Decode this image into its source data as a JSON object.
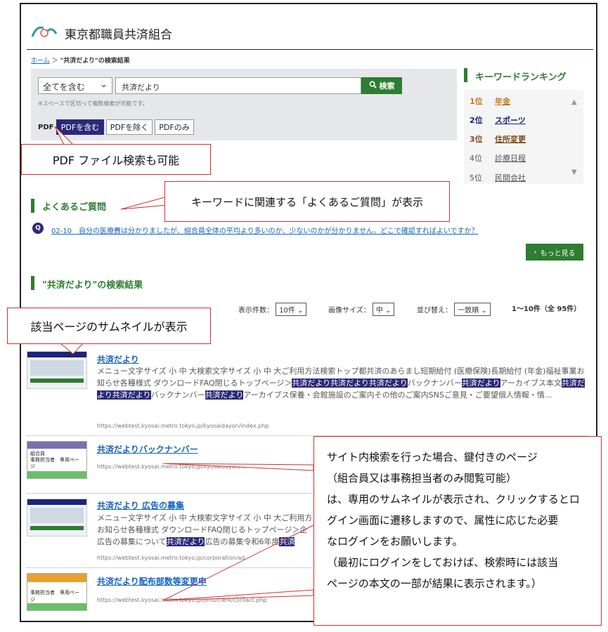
{
  "header": {
    "site_title": "東京都職員共済組合"
  },
  "breadcrumb": {
    "home": "ホーム",
    "separator": "＞",
    "current": "\"共済だより\"の検索結果"
  },
  "search": {
    "scope_value": "全てを含む",
    "keyword_value": "共済だより",
    "button_label": "検索",
    "hint": "※スペースで区切って複数検索が可能です。",
    "pdf_label": "PDF",
    "pdf_options": [
      "PDFを含む",
      "PDFを除く",
      "PDFのみ"
    ],
    "pdf_selected": "PDFを含む"
  },
  "ranking": {
    "title": "キーワードランキング",
    "items": [
      {
        "rank": "1位",
        "word": "年金",
        "color": "#c07a1a"
      },
      {
        "rank": "2位",
        "word": "スポーツ",
        "color": "#1a237e"
      },
      {
        "rank": "3位",
        "word": "住所変更",
        "color": "#7a4a1a"
      },
      {
        "rank": "4位",
        "word": "診療日程",
        "color": "#555555"
      },
      {
        "rank": "5位",
        "word": "民間会社",
        "color": "#555555"
      }
    ]
  },
  "faq": {
    "title": "よくあるご質問",
    "icon_label": "Q",
    "items": [
      "02-10　自分の医療費は分かりましたが、組合員全体の平均より多いのか、少ないのかが分かりません。どこで確認すればよいですか？"
    ],
    "more_button": "もっと見る"
  },
  "results": {
    "title": "\"共済だより\"の検索結果",
    "count_label": "表示件数：",
    "count_value": "10件",
    "image_size_label": "画像サイズ：",
    "image_size_value": "中",
    "sort_label": "並び替え：",
    "sort_value": "一致順",
    "range": "1〜10件（全 95件）",
    "items": [
      {
        "title": "共済だより",
        "snippet_parts": [
          {
            "t": "メニュー文字サイズ 小 中 大検索文字サイズ 小 中 大ご利用方法検索トップ都共済のあらまし短期給付 (医療保険)長期給付 (年金)福祉事業お知らせ各種様式 ダウンロードFAQ閉じるトップページ＞",
            "h": false
          },
          {
            "t": "共済だより共済だより共済だより",
            "h": true
          },
          {
            "t": "バックナンバー",
            "h": false
          },
          {
            "t": "共済だより",
            "h": true
          },
          {
            "t": "アーカイブス本文",
            "h": false
          },
          {
            "t": "共済だより共済だより",
            "h": true
          },
          {
            "t": "バックナンバー",
            "h": false
          },
          {
            "t": "共済だより",
            "h": true
          },
          {
            "t": "アーカイブス保養・会館施設のご案内その他のご案内SNSご意見・ご要望個人情報・情...",
            "h": false
          }
        ],
        "url": "https://webtest.kyosai.metro.tokyo.jp/kyosaidayori/index.php"
      },
      {
        "title": "共済だよりバックナンバー",
        "thumb_text": [
          "組合員",
          "事務担当者　専用ページ"
        ],
        "url": "https://webtest.kyosai.metro.tokyo.jp/kyosaidayori/..."
      },
      {
        "title": "共済だより 広告の募集",
        "snippet_parts": [
          {
            "t": "メニュー文字サイズ 小 中 大検索文字サイズ 小 中 大ご利用方",
            "h": false
          },
          {
            "t": "お知らせ各種様式 ダウンロードFAQ閉じるトップページ＞企",
            "h": false
          },
          {
            "t": "広告の募集について",
            "h": false
          },
          {
            "t": "共済だより",
            "h": true
          },
          {
            "t": "広告の募集令和6年度",
            "h": false
          },
          {
            "t": "共済",
            "h": true
          }
        ],
        "url": "https://webtest.kyosai.metro.tokyo.jp/corporation/ad"
      },
      {
        "title": "共済だより配布部数等変更申",
        "thumb_text": [
          "事務担当者　専用ページ"
        ],
        "url": "https://webtest.kyosai.metro.tokyo.jp/jimu/clerk/contact.php"
      }
    ]
  },
  "callouts": {
    "pdf": "PDF ファイル検索も可能",
    "faq": "キーワードに関連する「よくあるご質問」が表示",
    "thumbnail": "該当ページのサムネイルが表示",
    "locked": "サイト内検索を行った場合、鍵付きのページ\n（組合員又は事務担当者のみ閲覧可能）\nは、専用のサムネイルが表示され、クリックするとロ\nグイン画面に遷移しますので、属性に応じた必要\nなログインをお願いします。\n（最初にログインをしておけば、検索時には該当\nページの本文の一部が結果に表示されます。）"
  },
  "colors": {
    "accent_green": "#2e7d32",
    "navy": "#2a2a7a",
    "callout_border": "#d32f2f"
  }
}
